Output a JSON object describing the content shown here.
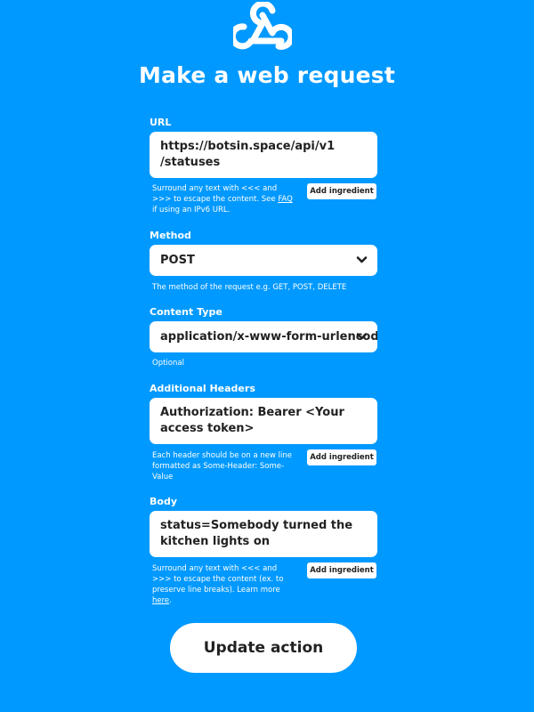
{
  "page": {
    "title": "Make a web request",
    "background_color": "#0099ff",
    "logo_icon": "webhooks-icon"
  },
  "fields": {
    "url": {
      "label": "URL",
      "value": "https://botsin.space/api/v1\n/statuses",
      "help_prefix": "Surround any text with <<< and >>> to escape the content. See ",
      "help_link": "FAQ",
      "help_suffix": " if using an IPv6 URL.",
      "ingredient_label": "Add ingredient"
    },
    "method": {
      "label": "Method",
      "selected": "POST",
      "help": "The method of the request e.g. GET, POST, DELETE"
    },
    "content_type": {
      "label": "Content Type",
      "selected": "application/x-www-form-urlencoded",
      "help": "Optional"
    },
    "headers": {
      "label": "Additional Headers",
      "value": "Authorization: Bearer <Your access token>",
      "help": "Each header should be on a new line formatted as Some-Header: Some-Value",
      "ingredient_label": "Add ingredient"
    },
    "body": {
      "label": "Body",
      "value": "status=Somebody turned the kitchen lights on",
      "help_prefix": "Surround any text with <<< and >>> to escape the content (ex. to preserve line breaks). Learn more ",
      "help_link": "here",
      "help_suffix": ".",
      "ingredient_label": "Add ingredient"
    }
  },
  "actions": {
    "update_label": "Update action"
  }
}
